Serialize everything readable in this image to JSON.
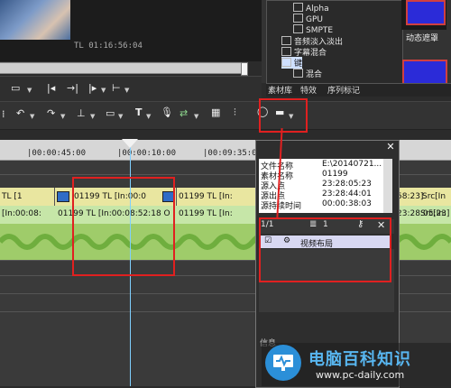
{
  "preview": {
    "timecode": "TL 01:16:56:04"
  },
  "right_panel": {
    "tree_items": [
      "Alpha",
      "GPU",
      "SMPTE",
      "音频淡入淡出",
      "字幕混合",
      "键",
      "混合"
    ],
    "thumb_label": "动态遮罩",
    "tabs": [
      "素材库",
      "特效",
      "序列标记"
    ]
  },
  "toolbar1": {
    "icons": [
      "monitor-icon",
      "mark-in-icon",
      "mark-out-icon",
      "split-icon",
      "trim-icon"
    ]
  },
  "toolbar2": {
    "text_tool_label": "T",
    "icons": [
      "undo-icon",
      "redo-icon",
      "razor-icon",
      "clip-icon",
      "text-icon",
      "mic-icon",
      "transition-icon",
      "grid-icon",
      "mixer-icon",
      "record-icon",
      "layout-icon"
    ]
  },
  "ruler": {
    "ticks": [
      "|00:00:45:00",
      "|00:00:10:00",
      "|00:09:35:00"
    ]
  },
  "tracks": {
    "video_clips": [
      "TL [1",
      "01199  TL [In:00:0",
      "01199  TL [In:",
      "58:23]",
      "Src[In"
    ],
    "audio_clips": [
      "[In:00:08:",
      "01199  TL [In:00:08:52:18  O",
      "01199  TL [In:",
      "23:28:05:23]",
      "Src[In:"
    ]
  },
  "info_panel": {
    "rows": [
      {
        "label": "文件名称",
        "value": "E:\\20140721..."
      },
      {
        "label": "素材名称",
        "value": "01199"
      },
      {
        "label": "源入点",
        "value": "23:28:05:23"
      },
      {
        "label": "源出点",
        "value": "23:28:44:01"
      },
      {
        "label": "源持续时间",
        "value": "00:00:38:03"
      }
    ],
    "page": "1/1",
    "count": "1",
    "layout_item": "视频布局",
    "footer": "信息"
  },
  "watermark": {
    "title": "电脑百科知识",
    "url": "www.pc-daily.com"
  },
  "colors": {
    "highlight": "#e02020",
    "video_track": "#e9e6a0",
    "audio_track": "#9fcc6a"
  }
}
